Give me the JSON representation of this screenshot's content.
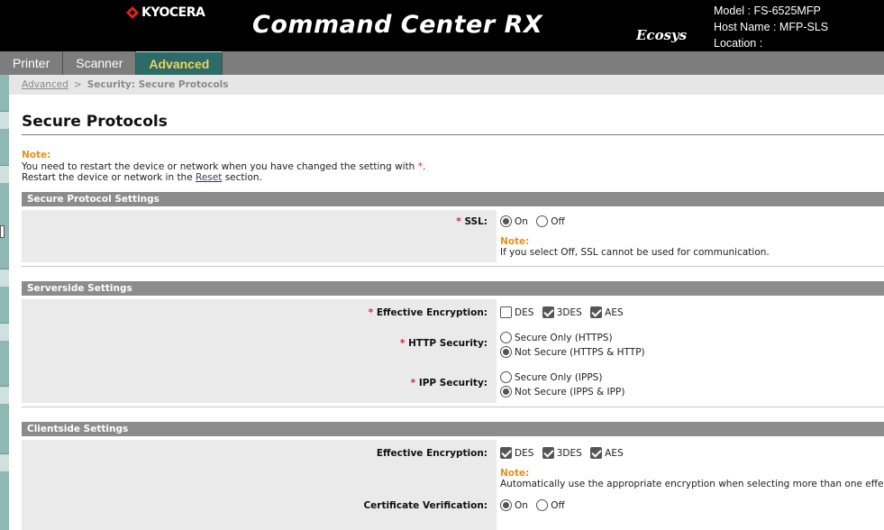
{
  "header": {
    "brand": "KYOCERA",
    "product": "Command Center RX",
    "ecosys": "Ecosys",
    "device": {
      "model": "Model : FS-6525MFP",
      "host": "Host Name : MFP-SLS",
      "location": "Location :"
    }
  },
  "tabs": [
    {
      "label": "Printer"
    },
    {
      "label": "Scanner"
    },
    {
      "label": "Advanced"
    }
  ],
  "breadcrumb": {
    "link": "Advanced",
    "separator": ">",
    "current": "Security: Secure Protocols"
  },
  "page": {
    "title": "Secure Protocols",
    "note_label": "Note:",
    "note_line1": "You need to restart the device or network when you have changed the setting with",
    "required_mark": "*",
    "note_period": ".",
    "note_line2_pre": "Restart the device or network in the",
    "reset_link": "Reset",
    "note_line2_post": "section."
  },
  "sections": {
    "secure_protocol": {
      "header": "Secure Protocol Settings",
      "ssl": {
        "label": "SSL:",
        "on": "On",
        "off": "Off",
        "note_label": "Note:",
        "note": "If you select Off, SSL cannot be used for communication."
      }
    },
    "serverside": {
      "header": "Serverside Settings",
      "encryption": {
        "label": "Effective Encryption:",
        "des": "DES",
        "tdes": "3DES",
        "aes": "AES"
      },
      "http": {
        "label": "HTTP Security:",
        "opt1": "Secure Only (HTTPS)",
        "opt2": "Not Secure (HTTPS & HTTP)"
      },
      "ipp": {
        "label": "IPP Security:",
        "opt1": "Secure Only (IPPS)",
        "opt2": "Not Secure (IPPS & IPP)"
      }
    },
    "clientside": {
      "header": "Clientside Settings",
      "encryption": {
        "label": "Effective Encryption:",
        "des": "DES",
        "tdes": "3DES",
        "aes": "AES",
        "note_label": "Note:",
        "note": "Automatically use the appropriate encryption when selecting more than one effective"
      },
      "cert": {
        "label": "Certificate Verification:",
        "on": "On",
        "off": "Off"
      }
    }
  }
}
